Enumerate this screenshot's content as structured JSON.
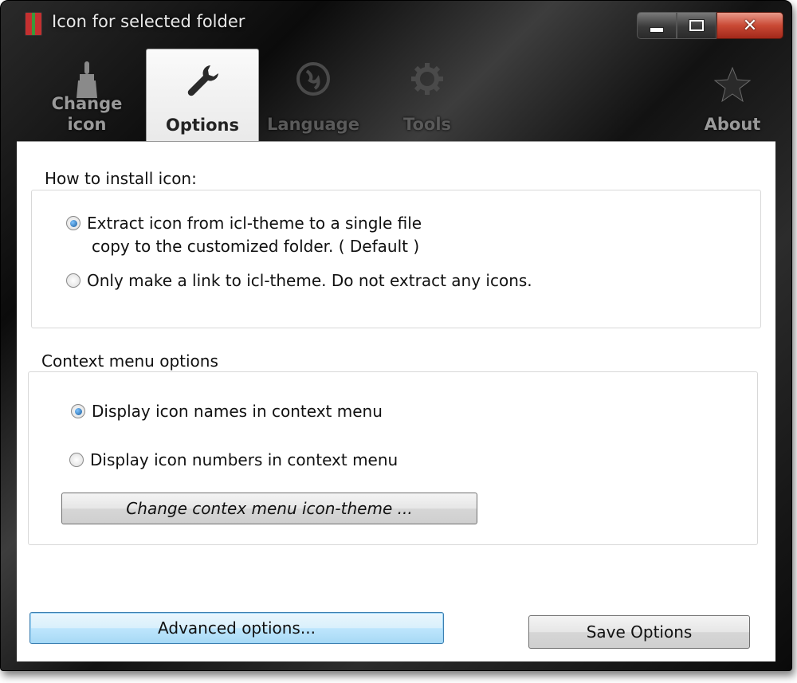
{
  "window": {
    "title": "Icon for selected folder",
    "controls": {
      "minimize": "minimize",
      "maximize": "maximize",
      "close": "✕"
    }
  },
  "tabs": [
    {
      "label": "Change icon",
      "icon": "paintbrush-icon"
    },
    {
      "label": "Options",
      "icon": "wrench-icon"
    },
    {
      "label": "Language",
      "icon": "globe-icon"
    },
    {
      "label": "Tools",
      "icon": "gear-icon"
    },
    {
      "label": "About",
      "icon": "star-icon"
    }
  ],
  "install_group": {
    "title": "How to install icon:",
    "option_extract": "Extract icon from icl-theme to a single file copy to the customized folder. ( Default )",
    "option_extract_line1": "Extract icon from icl-theme to a single file",
    "option_extract_line2": "copy to the customized folder. ( Default )",
    "option_link": "Only make a link to icl-theme. Do not extract any icons.",
    "selected": "extract"
  },
  "context_group": {
    "title": "Context menu options",
    "option_names": "Display icon names in context menu",
    "option_numbers": "Display icon numbers in context menu",
    "selected": "names",
    "theme_button": "Change contex menu icon-theme ..."
  },
  "footer": {
    "advanced_button": "Advanced options...",
    "save_button": "Save Options"
  },
  "colors": {
    "accent": "#1a5c9c",
    "titlebar": "#1a1a1a",
    "close_button": "#c94a35"
  }
}
